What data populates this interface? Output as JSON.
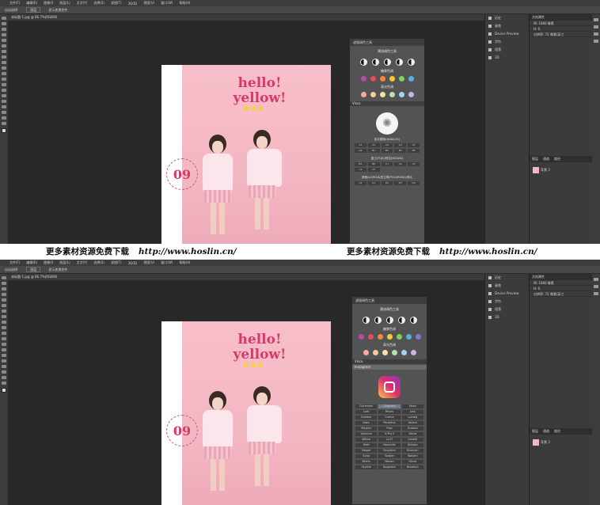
{
  "top_screen": {
    "menu_items": [
      "文件(F)",
      "编辑(E)",
      "图像(I)",
      "图层(L)",
      "文字(Y)",
      "选择(S)",
      "滤镜(T)",
      "3D(D)",
      "视图(V)",
      "窗口(W)",
      "帮助(H)"
    ],
    "options": [
      "自动选择:",
      "图层",
      "显示变换控件"
    ],
    "doc_tab": "未标题-1.jpg @ 66.7%(RGB/8)",
    "poster": {
      "headline_line1": "hello!",
      "headline_line2": "yellow!",
      "badge_number": "09"
    },
    "plugin_panel": {
      "title": "滤镜调色工具",
      "brand": "潮流调色工具",
      "section_candy": "糖果色调",
      "section_macaron": "高光色调",
      "bar_vsco": "Visco",
      "section_film": "胶片模拟(ANALOG)",
      "section_fujifilm": "富士(FUJI)/柯达(KODAK)",
      "section_more": "其他(LOMO)&拍立得(POLAROID)/底片",
      "film_cells": [
        "A1",
        "A2",
        "A3",
        "A4",
        "A5",
        "A6",
        "B1",
        "B2",
        "B3",
        "B4",
        "B5",
        "B6",
        "C1",
        "C2",
        "C3",
        "C4",
        "C5",
        "C6",
        "D1",
        "D2",
        "D3",
        "D4",
        "D5",
        "D6"
      ]
    },
    "right_panel": {
      "items": [
        "历史",
        "画笔",
        "Device Preview",
        "字符",
        "段落",
        "3D"
      ],
      "props_title": "文档属性",
      "props_rows": [
        "W: 1080 像素",
        "H: 0",
        "分辨率: 72 像素/英寸"
      ],
      "layer_tabs": [
        "图层",
        "通道",
        "路径"
      ],
      "layer_name": "背景 3"
    }
  },
  "bottom_screen": {
    "menu_items": [
      "文件(F)",
      "编辑(E)",
      "图像(I)",
      "图层(L)",
      "文字(Y)",
      "选择(S)",
      "滤镜(T)",
      "3D(D)",
      "视图(V)",
      "窗口(W)",
      "帮助(H)"
    ],
    "options": [
      "自动选择:",
      "图层",
      "显示变换控件"
    ],
    "doc_tab": "未标题-1.jpg @ 66.7%(RGB/8)",
    "poster": {
      "headline_line1": "hello!",
      "headline_line2": "yellow!",
      "badge_number": "09"
    },
    "plugin_panel": {
      "title": "滤镜调色工具",
      "brand": "潮流调色工具",
      "section_candy": "糖果色调",
      "section_macaron": "高光色调",
      "bar_vsco": "Visco",
      "bar_instagram": "Instagram",
      "ig_filters": [
        "Clarendon",
        "Gingham",
        "Moon",
        "Lark",
        "Reyes",
        "Juno",
        "Slumber",
        "Crema",
        "Ludwig",
        "Aden",
        "Perpetua",
        "Amaro",
        "Mayfair",
        "Rise",
        "Hudson",
        "Valencia",
        "X-Pro II",
        "Sierra",
        "Willow",
        "Lo-Fi",
        "Inkwell",
        "Hefe",
        "Nashville",
        "Stinson",
        "Vesper",
        "Earlybird",
        "Brannan",
        "Sutro",
        "Toaster",
        "Walden",
        "Kelvin",
        "Maven",
        "Ginza",
        "Skyline",
        "Dogpatch",
        "Brooklyn"
      ]
    },
    "right_panel": {
      "items": [
        "历史",
        "画笔",
        "Device Preview",
        "字符",
        "段落",
        "3D"
      ],
      "props_title": "文档属性",
      "props_rows": [
        "W: 1080 像素",
        "H: 0",
        "分辨率: 72 像素/英寸"
      ],
      "layer_tabs": [
        "图层",
        "通道",
        "路径"
      ],
      "layer_name": "背景 3"
    }
  },
  "watermark": {
    "left_text": "更多素材资源免费下载",
    "left_url": "http://www.hoslin.cn/",
    "right_text": "更多素材资源免费下载",
    "right_url": "http://www.hoslin.cn/"
  },
  "colors": {
    "candy": [
      "#b14fa0",
      "#e24d5a",
      "#f08a3a",
      "#f3cc3b",
      "#7fd068",
      "#53b3e0",
      "#7f7ad9"
    ],
    "macaron": [
      "#f5a8a8",
      "#f7c99c",
      "#f5e3a0",
      "#b8e3a8",
      "#a6d3ee",
      "#c3b5ea"
    ],
    "headline": "#d9386b"
  }
}
